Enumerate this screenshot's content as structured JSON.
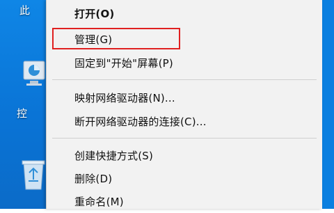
{
  "desktop": {
    "label_top": "此",
    "label_mid": "控",
    "icons": {
      "this_pc": "computer-icon",
      "recycle_bin": "recycle-bin-icon"
    }
  },
  "context_menu": {
    "items": [
      {
        "label": "打开(O)",
        "bold": true
      },
      {
        "label": "管理(G)",
        "highlighted": true
      },
      {
        "label": "固定到\"开始\"屏幕(P)"
      },
      {
        "label": "映射网络驱动器(N)..."
      },
      {
        "label": "断开网络驱动器的连接(C)..."
      },
      {
        "label": "创建快捷方式(S)"
      },
      {
        "label": "删除(D)"
      },
      {
        "label": "重命名(M)"
      }
    ]
  },
  "colors": {
    "desktop_blue": "#0a74d6",
    "menu_bg": "#f2f2f2",
    "highlight_border": "#e02020"
  }
}
